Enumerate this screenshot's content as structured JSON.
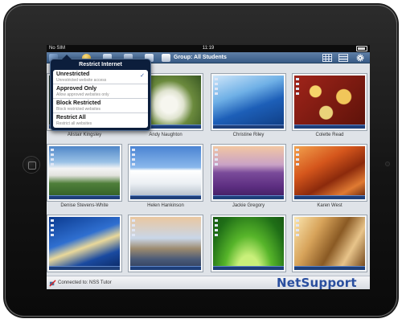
{
  "status_bar": {
    "carrier": "No SIM",
    "time": "11:19"
  },
  "toolbar": {
    "group_label": "Group: All Students"
  },
  "restrict_menu": {
    "title": "Restrict Internet",
    "options": [
      {
        "label": "Unrestricted",
        "description": "Unrestricted website access",
        "selected": true
      },
      {
        "label": "Approved Only",
        "description": "Allow approved websites only",
        "selected": false
      },
      {
        "label": "Block Restricted",
        "description": "Block restricted websites",
        "selected": false
      },
      {
        "label": "Restrict All",
        "description": "Restrict all websites",
        "selected": false
      }
    ],
    "check_mark": "✓"
  },
  "students": [
    {
      "name": "Alistair Kingsley",
      "wallpaper": "flower-white"
    },
    {
      "name": "Andy Naughton",
      "wallpaper": "hydrangea"
    },
    {
      "name": "Christine Riley",
      "wallpaper": "blue-architecture"
    },
    {
      "name": "Colette Read",
      "wallpaper": "autumn-leaves"
    },
    {
      "name": "Denise Stevens-White",
      "wallpaper": "white-cliffs"
    },
    {
      "name": "Helen Hankinson",
      "wallpaper": "modern-building"
    },
    {
      "name": "Jackie Gregory",
      "wallpaper": "lavender-field"
    },
    {
      "name": "Karen West",
      "wallpaper": "red-canyon"
    },
    {
      "name": "",
      "wallpaper": "bridge-sky"
    },
    {
      "name": "",
      "wallpaper": "tower-bridge"
    },
    {
      "name": "",
      "wallpaper": "green-leaves"
    },
    {
      "name": "",
      "wallpaper": "golden-curves"
    }
  ],
  "footer": {
    "connection": "Connected to: NSS Tutor",
    "brand": "NetSupport"
  }
}
